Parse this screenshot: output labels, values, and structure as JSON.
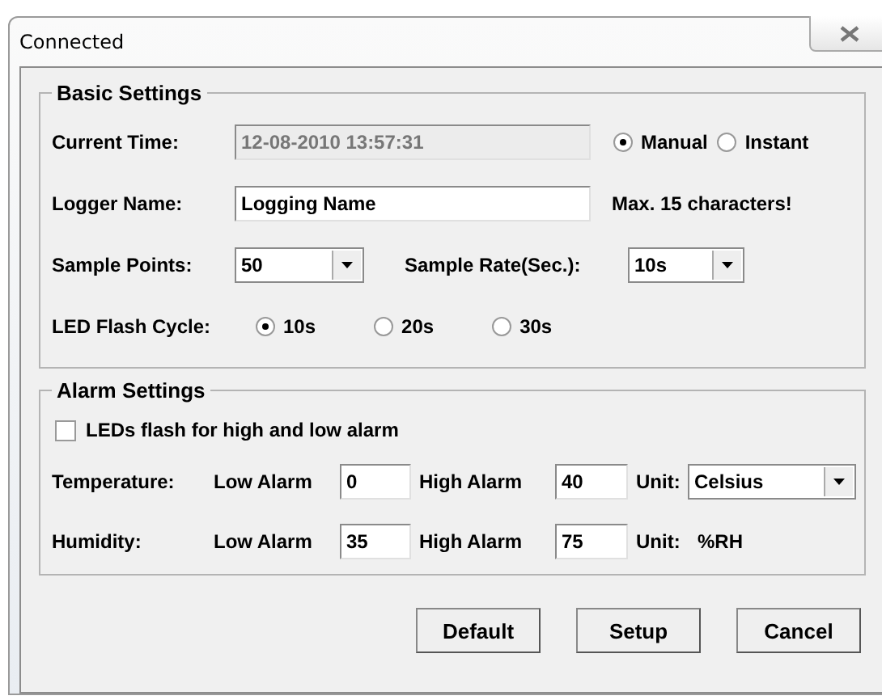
{
  "window": {
    "title": "Connected"
  },
  "basic_settings": {
    "title": "Basic Settings",
    "current_time": {
      "label": "Current Time:",
      "value": "12-08-2010 13:57:31",
      "disabled": true
    },
    "time_mode": [
      {
        "label": "Manual",
        "selected": true
      },
      {
        "label": "Instant",
        "selected": false
      }
    ],
    "logger_name": {
      "label": "Logger Name:",
      "value": "Logging Name",
      "note": "Max. 15 characters!"
    },
    "sample_points": {
      "label": "Sample Points:",
      "value": "50"
    },
    "sample_rate": {
      "label": "Sample Rate(Sec.):",
      "value": "10s"
    },
    "led_flash_cycle": {
      "label": "LED Flash Cycle:",
      "options": [
        {
          "label": "10s",
          "selected": true
        },
        {
          "label": "20s",
          "selected": false
        },
        {
          "label": "30s",
          "selected": false
        }
      ]
    }
  },
  "alarm_settings": {
    "title": "Alarm Settings",
    "led_alarm": {
      "label": "LEDs flash for high and low alarm",
      "checked": false
    },
    "rows": [
      {
        "kind": "select",
        "label": "Temperature:",
        "low_label": "Low Alarm",
        "low": "0",
        "high_label": "High Alarm",
        "high": "40",
        "unit_label": "Unit:",
        "unit": "Celsius"
      },
      {
        "kind": "text",
        "label": "Humidity:",
        "low_label": "Low Alarm",
        "low": "35",
        "high_label": "High Alarm",
        "high": "75",
        "unit_label": "Unit:",
        "unit": "%RH"
      }
    ]
  },
  "buttons": [
    "Default",
    "Setup",
    "Cancel"
  ]
}
